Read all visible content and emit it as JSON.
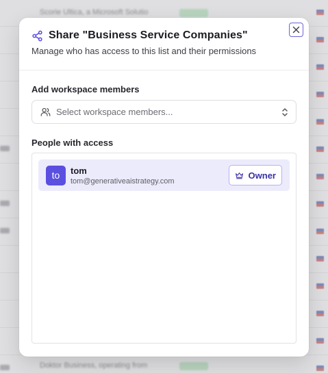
{
  "background": {
    "rows": [
      {
        "text": "Scorie Ultica, a Microsoft Solutio",
        "tag": true
      },
      {
        "text": "",
        "tag": false
      },
      {
        "text": "Doktor Business, operating from",
        "tag": true
      }
    ]
  },
  "modal": {
    "title": "Share \"Business Service Companies\"",
    "subtitle": "Manage who has access to this list and their permissions",
    "add_members_label": "Add workspace members",
    "select_placeholder": "Select workspace members...",
    "people_label": "People with access",
    "people": [
      {
        "initials": "to",
        "name": "tom",
        "email": "tom@generativeaistrategy.com",
        "role": "Owner"
      }
    ]
  },
  "colors": {
    "accent": "#5b4fe0",
    "role_text": "#3a31a6",
    "row_highlight": "#ecebfb"
  },
  "icons": {
    "title": "share-icon",
    "close": "close-icon",
    "select_left": "users-icon",
    "select_right": "chevron-up-down-icon",
    "role": "crown-icon"
  }
}
